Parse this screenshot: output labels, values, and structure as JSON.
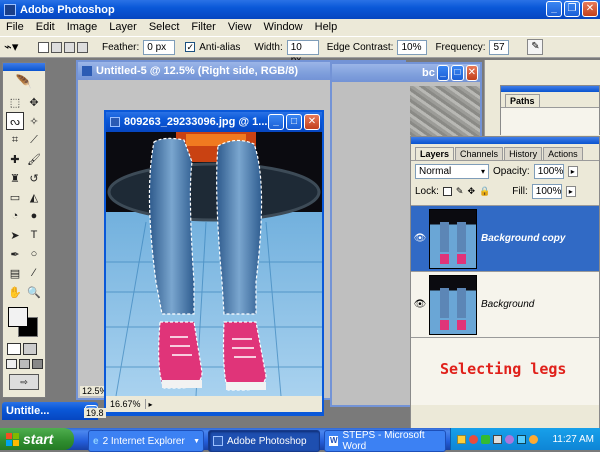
{
  "app": {
    "title": "Adobe Photoshop"
  },
  "menu": [
    "File",
    "Edit",
    "Image",
    "Layer",
    "Select",
    "Filter",
    "View",
    "Window",
    "Help"
  ],
  "options": {
    "feather_label": "Feather:",
    "feather_value": "0 px",
    "antialias_label": "Anti-alias",
    "width_label": "Width:",
    "width_value": "10 px",
    "edge_label": "Edge Contrast:",
    "edge_value": "10%",
    "freq_label": "Frequency:",
    "freq_value": "57"
  },
  "doc_back": {
    "title": "Untitled-5 @ 12.5% (Right side, RGB/8)",
    "zoom": "12.5%"
  },
  "doc_mid": {
    "title": "bc"
  },
  "doc_front": {
    "title": "809263_29233096.jpg @ 1...",
    "zoom": "16.67%"
  },
  "doc_min": {
    "title": "Untitle...",
    "zoom": "19.8"
  },
  "paths_panel": {
    "tab": "Paths"
  },
  "layers_panel": {
    "tabs": [
      "Layers",
      "Channels",
      "History",
      "Actions"
    ],
    "blend_mode": "Normal",
    "opacity_label": "Opacity:",
    "opacity_value": "100%",
    "lock_label": "Lock:",
    "fill_label": "Fill:",
    "fill_value": "100%",
    "layers": [
      {
        "name": "Background copy",
        "selected": true
      },
      {
        "name": "Background",
        "selected": false
      }
    ]
  },
  "annotation": "Selecting legs",
  "taskbar": {
    "start": "start",
    "buttons": [
      "2 Internet Explorer",
      "Adobe Photoshop",
      "STEPS - Microsoft Word"
    ],
    "clock": "11:27 AM"
  },
  "colors": {
    "xp_blue": "#0a58d8",
    "annotation_red": "#e0201a",
    "panel_bg": "#ece9d8"
  }
}
